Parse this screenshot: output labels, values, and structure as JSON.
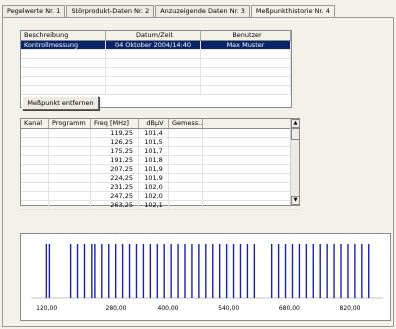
{
  "tabs": [
    "Pegelwerte Nr. 1",
    "Störprodukt-Daten Nr. 2",
    "Anzuzeigende Daten Nr. 3",
    "Meßpunkthistorie Nr. 4"
  ],
  "history": {
    "columns": [
      "Beschreibung",
      "Datum/Zeit",
      "Benutzer"
    ],
    "rows": [
      {
        "beschreibung": "Kontrollmessung",
        "datum": "04 Oktober 2004/14:40",
        "benutzer": "Max Muster"
      }
    ]
  },
  "delete_button": "Meßpunkt entfernen",
  "points": {
    "columns": [
      "Kanal",
      "Programm",
      "Freq [MHz]",
      "dBµV",
      "Gemess..."
    ],
    "rows": [
      {
        "freq": "119,25",
        "dbuv": "101,4"
      },
      {
        "freq": "126,25",
        "dbuv": "101,5"
      },
      {
        "freq": "175,25",
        "dbuv": "101,7"
      },
      {
        "freq": "191,25",
        "dbuv": "101,8"
      },
      {
        "freq": "207,25",
        "dbuv": "101,9"
      },
      {
        "freq": "224,25",
        "dbuv": "101,9"
      },
      {
        "freq": "231,25",
        "dbuv": "102,0"
      },
      {
        "freq": "247,25",
        "dbuv": "102,0"
      },
      {
        "freq": "263,25",
        "dbuv": "102,1"
      }
    ]
  },
  "spectrum": {
    "x_ticks": [
      "120,00",
      "280,00",
      "400,00",
      "540,00",
      "680,00",
      "820,00"
    ],
    "line_color": "#1a23a8",
    "freqs": [
      119.25,
      126.25,
      175.25,
      191.25,
      207.25,
      224.25,
      231.25,
      247.25,
      263.25,
      279.25,
      295.25,
      311.25,
      327.25,
      343.25,
      359.25,
      375.25,
      391.25,
      407.25,
      423.25,
      439.25,
      455.25,
      471.25,
      487.25,
      503.25,
      519.25,
      535.25,
      551.25,
      567.25,
      583.25,
      599.25,
      639.25,
      655.25,
      671.25,
      687.25,
      703.25,
      719.25,
      735.25,
      751.25,
      767.25,
      783.25,
      799.25,
      815.25,
      831.25,
      847.25,
      863.25
    ]
  }
}
